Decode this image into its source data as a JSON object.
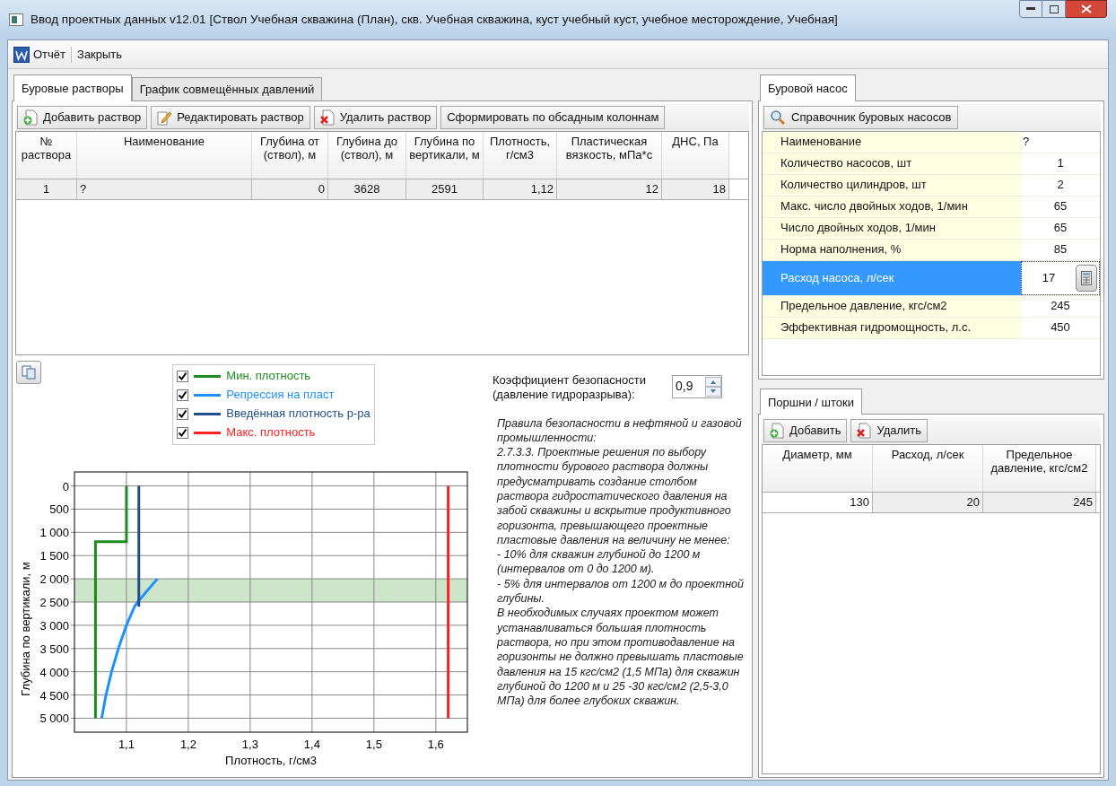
{
  "window": {
    "title": "Ввод проектных данных v12.01 [Ствол Учебная скважина (План), скв. Учебная скважина, куст учебный куст, учебное месторождение, Учебная]"
  },
  "toolbar": [
    {
      "label": "Отчёт",
      "kind": "word"
    },
    {
      "label": "Закрыть",
      "kind": "plain"
    }
  ],
  "left_tabs": [
    {
      "label": "Буровые растворы",
      "selected": true
    },
    {
      "label": "График совмещённых давлений",
      "selected": false
    }
  ],
  "mud_buttons": [
    {
      "label": "Добавить раствор",
      "kind": "add"
    },
    {
      "label": "Редактировать раствор",
      "kind": "edit"
    },
    {
      "label": "Удалить раствор",
      "kind": "delete"
    },
    {
      "label": "Сформировать по обсадным колоннам",
      "kind": "plain"
    }
  ],
  "mud_table": {
    "columns": [
      "№ раствора",
      "Наименование",
      "Глубина от (ствол), м",
      "Глубина до (ствол), м",
      "Глубина по вертикали, м",
      "Плотность, г/см3",
      "Пластическая вязкость, мПа*с",
      "ДНС, Па"
    ],
    "rows": [
      [
        "1",
        "?",
        "0",
        "3628",
        "2591",
        "1,12",
        "12",
        "18"
      ]
    ]
  },
  "chart": {
    "legend_checkboxes": [
      {
        "checked": true
      },
      {
        "checked": true
      },
      {
        "checked": true
      },
      {
        "checked": true
      }
    ],
    "chart_data": {
      "type": "line",
      "orientation": "horizontal",
      "grid": true,
      "legend": "top",
      "xlabel": "Плотность, г/см3",
      "ylabel": "Глубина по вертикали, м",
      "xlim": [
        1.016,
        1.651
      ],
      "ylim": [
        5300,
        -300
      ],
      "x": [
        0,
        1200,
        1200,
        2000,
        2250,
        2500,
        2600,
        3000,
        3500,
        4000,
        4500,
        5000
      ],
      "xticks": [
        {
          "value": 1.1,
          "label": "1,1"
        },
        {
          "value": 1.2,
          "label": "1,2"
        },
        {
          "value": 1.3,
          "label": "1,3"
        },
        {
          "value": 1.4,
          "label": "1,4"
        },
        {
          "value": 1.5,
          "label": "1,5"
        },
        {
          "value": 1.6,
          "label": "1,6"
        }
      ],
      "yticks": [
        {
          "value": 0,
          "label": "0"
        },
        {
          "value": 500,
          "label": "500"
        },
        {
          "value": 1000,
          "label": "1 000"
        },
        {
          "value": 1500,
          "label": "1 500"
        },
        {
          "value": 2000,
          "label": "2 000"
        },
        {
          "value": 2500,
          "label": "2 500"
        },
        {
          "value": 3000,
          "label": "3 000"
        },
        {
          "value": 3500,
          "label": "3 500"
        },
        {
          "value": 4000,
          "label": "4 000"
        },
        {
          "value": 4500,
          "label": "4 500"
        },
        {
          "value": 5000,
          "label": "5 000"
        }
      ],
      "series": [
        {
          "name": "Мин. плотность",
          "color": "#1e8c1e",
          "values": [
            1.1,
            1.1,
            1.05,
            1.05,
            1.05,
            1.05,
            1.05,
            1.05,
            1.05,
            1.05,
            1.05,
            1.05
          ]
        },
        {
          "name": "Репрессия на пласт",
          "color": "#1e90ff",
          "values": [
            null,
            null,
            null,
            1.15,
            1.134,
            1.118,
            1.113,
            1.1,
            1.087,
            1.076,
            1.067,
            1.06
          ]
        },
        {
          "name": "Введённая плотность р-ра",
          "color": "#1f4e8c",
          "values": [
            1.12,
            1.12,
            1.12,
            1.12,
            1.12,
            1.12,
            1.12,
            null,
            null,
            null,
            null,
            null
          ]
        },
        {
          "name": "Макс. плотность",
          "color": "#ff2020",
          "values": [
            1.62,
            1.62,
            1.62,
            1.62,
            1.62,
            1.62,
            1.62,
            1.62,
            1.62,
            1.62,
            1.62,
            1.62
          ]
        }
      ],
      "bands": [
        {
          "axis": "y",
          "from": 2000,
          "to": 2500
        }
      ]
    }
  },
  "safety": {
    "label": "Коэффициент безопасности (давление гидроразрыва):",
    "value": "0,9"
  },
  "rules": [
    "Правила безопасности в нефтяной и газовой промышленности:",
    "2.7.3.3. Проектные решения по выбору плотности бурового раствора должны предусматривать создание столбом раствора гидростатического давления на забой скважины и вскрытие продуктивного горизонта, превышающего проектные",
    "пластовые давления на величину не менее:",
    "- 10% для скважин глубиной до 1200 м (интервалов от 0 до 1200 м).",
    "- 5% для интервалов от 1200 м до проектной глубины.",
    "В необходимых случаях проектом может устанавливаться большая плотность раствора, но при этом противодавление на горизонты не должно превышать пластовые давления на 15 кгс/см2  (1,5 МПа) для скважин глубиной до 1200 м и 25 -30 кгс/см2  (2,5-3,0 МПа) для более глубоких скважин."
  ],
  "pump_tabs": [
    {
      "label": "Буровой насос",
      "selected": true
    }
  ],
  "pump_button": {
    "label": "Справочник буровых насосов"
  },
  "pump_props": [
    {
      "name": "Наименование",
      "value": "?",
      "selected": false,
      "kind": "text"
    },
    {
      "name": "Количество насосов, шт",
      "value": "1",
      "selected": false,
      "kind": "number"
    },
    {
      "name": "Количество цилиндров, шт",
      "value": "2",
      "selected": false,
      "kind": "number"
    },
    {
      "name": "Макс. число двойных ходов, 1/мин",
      "value": "65",
      "selected": false,
      "kind": "number"
    },
    {
      "name": "Число двойных ходов, 1/мин",
      "value": "65",
      "selected": false,
      "kind": "number"
    },
    {
      "name": "Норма наполнения, %",
      "value": "85",
      "selected": false,
      "kind": "number"
    },
    {
      "name": "Расход насоса, л/сек",
      "value": "17",
      "selected": true,
      "kind": "calc"
    },
    {
      "name": "Предельное давление, кгс/см2",
      "value": "245",
      "selected": false,
      "kind": "number"
    },
    {
      "name": "Эффективная гидромощность, л.с.",
      "value": "450",
      "selected": false,
      "kind": "number"
    }
  ],
  "piston_tabs": [
    {
      "label": "Поршни / штоки",
      "selected": true
    }
  ],
  "piston_buttons": [
    {
      "label": "Добавить",
      "kind": "add"
    },
    {
      "label": "Удалить",
      "kind": "delete"
    }
  ],
  "piston_table": {
    "columns": [
      "Диаметр, мм",
      "Расход, л/сек",
      "Предельное давление, кгс/см2"
    ],
    "rows": [
      [
        "130",
        "20",
        "245"
      ]
    ]
  }
}
